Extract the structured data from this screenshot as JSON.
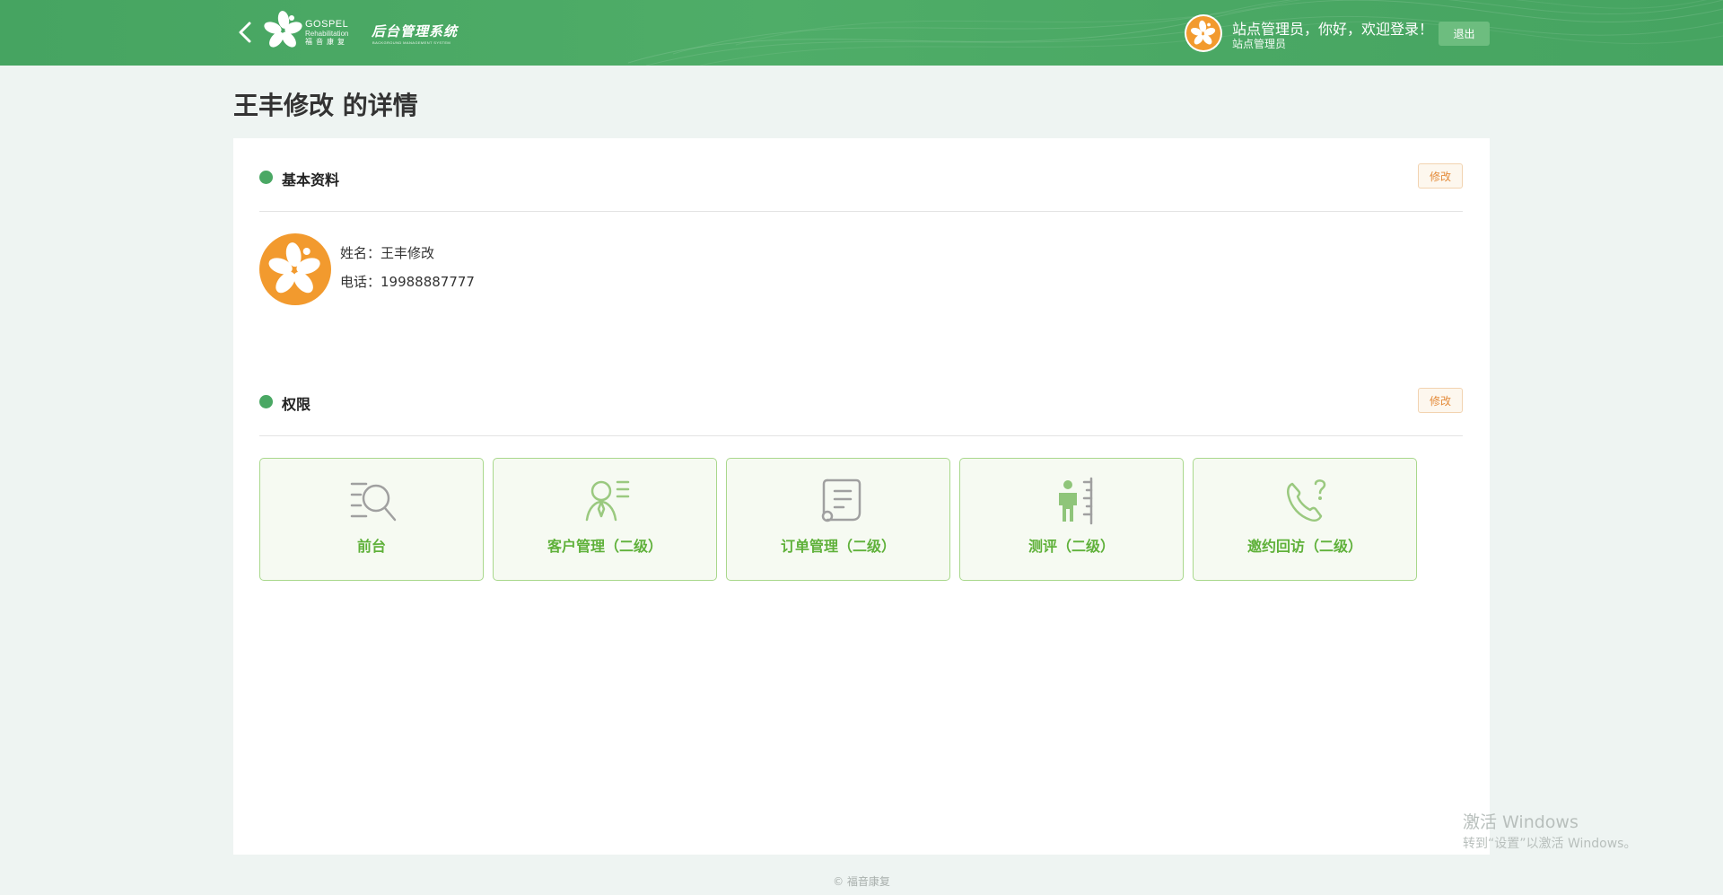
{
  "header": {
    "brand_en": "GOSPEL",
    "brand_sub": "Rehabilitation",
    "brand_cn": "福音康复",
    "system_title": "后台管理系统",
    "system_subtitle": "BACKGROUND MANAGEMENT SYSTEM",
    "greeting": "站点管理员，你好，欢迎登录！",
    "role": "站点管理员",
    "logout_label": "退出"
  },
  "page": {
    "title": "王丰修改 的详情"
  },
  "basic_info": {
    "section_label": "基本资料",
    "edit_label": "修改",
    "name_line": "姓名：王丰修改",
    "phone_line": "电话：19988887777"
  },
  "permissions": {
    "section_label": "权限",
    "edit_label": "修改",
    "items": [
      {
        "label": "前台",
        "icon": "reception-search-icon"
      },
      {
        "label": "客户管理（二级）",
        "icon": "customer-list-icon"
      },
      {
        "label": "订单管理（二级）",
        "icon": "order-scroll-icon"
      },
      {
        "label": "测评（二级）",
        "icon": "height-measure-icon"
      },
      {
        "label": "邀约回访（二级）",
        "icon": "phone-question-icon"
      }
    ]
  },
  "footer": {
    "copyright": "© 福音康复"
  },
  "watermark": {
    "title": "激活 Windows",
    "subtitle": "转到“设置”以激活 Windows。"
  },
  "colors": {
    "primary_green": "#4aa864",
    "tile_green": "#5fb13a",
    "accent_orange": "#f29a2e"
  }
}
